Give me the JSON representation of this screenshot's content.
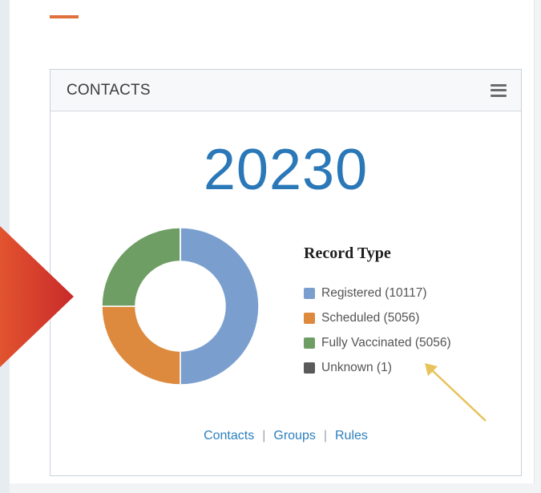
{
  "card": {
    "title": "CONTACTS",
    "total": "20230"
  },
  "chart_data": {
    "type": "pie",
    "donut": true,
    "title": "Record Type",
    "legend_position": "right",
    "series": [
      {
        "name": "Registered",
        "value": 10117,
        "label": "Registered (10117)",
        "color": "#7a9fcf"
      },
      {
        "name": "Scheduled",
        "value": 5056,
        "label": "Scheduled (5056)",
        "color": "#de8a3e"
      },
      {
        "name": "Fully Vaccinated",
        "value": 5056,
        "label": "Fully Vaccinated (5056)",
        "color": "#6f9e64"
      },
      {
        "name": "Unknown",
        "value": 1,
        "label": "Unknown (1)",
        "color": "#5a5a5a"
      }
    ]
  },
  "footer": {
    "links": [
      "Contacts",
      "Groups",
      "Rules"
    ],
    "separator": "|"
  },
  "colors": {
    "accent": "#e0703c",
    "number": "#2a78b8",
    "link": "#2c7fbd",
    "red_arrow": "#d6402c",
    "yellow_arrow": "#e8c25a"
  },
  "icons": {
    "menu": "hamburger-menu-icon",
    "left_arrow": "red-arrow-icon",
    "pointer": "yellow-arrow-icon"
  }
}
